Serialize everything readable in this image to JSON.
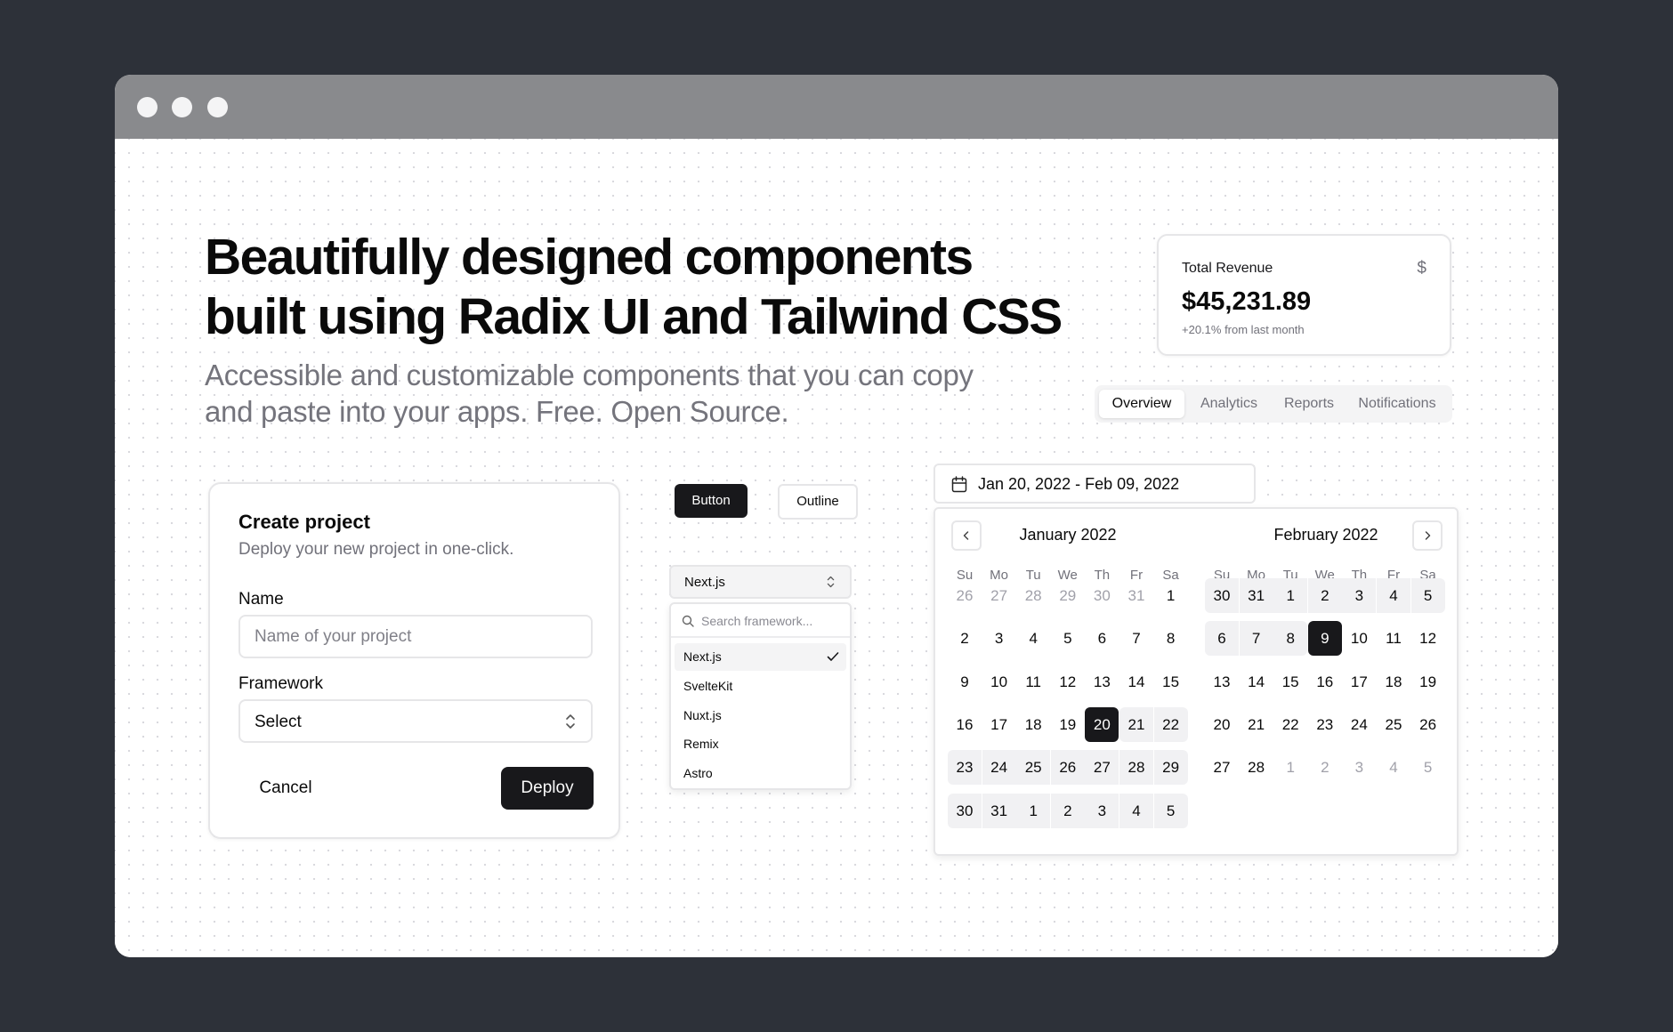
{
  "hero": {
    "title_line1": "Beautifully designed components",
    "title_line2": "built using Radix UI and Tailwind CSS",
    "subtitle_line1": "Accessible and customizable components that you can copy",
    "subtitle_line2": "and paste into your apps. Free. Open Source."
  },
  "revenue": {
    "title": "Total Revenue",
    "icon": "$",
    "value": "$45,231.89",
    "change": "+20.1% from last month"
  },
  "tabs": [
    "Overview",
    "Analytics",
    "Reports",
    "Notifications"
  ],
  "create_project": {
    "title": "Create project",
    "description": "Deploy your new project in one-click.",
    "name_label": "Name",
    "name_placeholder": "Name of your project",
    "framework_label": "Framework",
    "framework_value": "Select",
    "cancel": "Cancel",
    "deploy": "Deploy"
  },
  "buttons": {
    "primary": "Button",
    "outline": "Outline"
  },
  "combobox": {
    "selected": "Next.js",
    "search_placeholder": "Search framework...",
    "options": [
      "Next.js",
      "SvelteKit",
      "Nuxt.js",
      "Remix",
      "Astro"
    ]
  },
  "date_range": {
    "label": "Jan 20, 2022 - Feb 09, 2022",
    "weekdays": [
      "Su",
      "Mo",
      "Tu",
      "We",
      "Th",
      "Fr",
      "Sa"
    ],
    "months": [
      {
        "title": "January 2022",
        "weeks": [
          [
            "26",
            "27",
            "28",
            "29",
            "30",
            "31",
            "1"
          ],
          [
            "2",
            "3",
            "4",
            "5",
            "6",
            "7",
            "8"
          ],
          [
            "9",
            "10",
            "11",
            "12",
            "13",
            "14",
            "15"
          ],
          [
            "16",
            "17",
            "18",
            "19",
            "20",
            "21",
            "22"
          ],
          [
            "23",
            "24",
            "25",
            "26",
            "27",
            "28",
            "29"
          ],
          [
            "30",
            "31",
            "1",
            "2",
            "3",
            "4",
            "5"
          ]
        ]
      },
      {
        "title": "February 2022",
        "weeks": [
          [
            "30",
            "31",
            "1",
            "2",
            "3",
            "4",
            "5"
          ],
          [
            "6",
            "7",
            "8",
            "9",
            "10",
            "11",
            "12"
          ],
          [
            "13",
            "14",
            "15",
            "16",
            "17",
            "18",
            "19"
          ],
          [
            "20",
            "21",
            "22",
            "23",
            "24",
            "25",
            "26"
          ],
          [
            "27",
            "28",
            "1",
            "2",
            "3",
            "4",
            "5"
          ]
        ]
      }
    ]
  }
}
